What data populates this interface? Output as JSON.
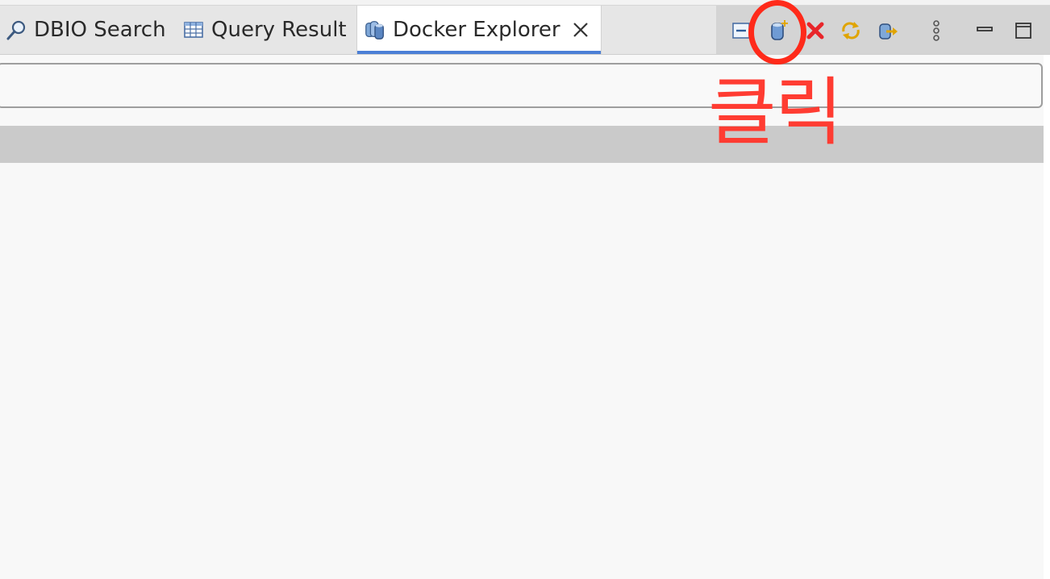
{
  "tabs": [
    {
      "label": "DBIO Search",
      "icon": "magnifier-icon",
      "active": false
    },
    {
      "label": "Query Result",
      "icon": "table-icon",
      "active": false
    },
    {
      "label": "Docker Explorer",
      "icon": "docker-db-icon",
      "active": true
    }
  ],
  "toolbar": {
    "buttons": [
      {
        "icon": "collapse-all-icon"
      },
      {
        "icon": "add-connection-icon"
      },
      {
        "icon": "delete-icon"
      },
      {
        "icon": "refresh-icon"
      },
      {
        "icon": "import-icon"
      },
      {
        "icon": "view-menu-icon"
      },
      {
        "icon": "minimize-icon"
      },
      {
        "icon": "maximize-icon"
      }
    ]
  },
  "search": {
    "value": "",
    "placeholder": ""
  },
  "annotation": {
    "text": "클릭",
    "color": "#ff3c32"
  },
  "colors": {
    "active_tab_underline": "#4b7fd6",
    "annotation_circle": "#ff2a1a"
  }
}
